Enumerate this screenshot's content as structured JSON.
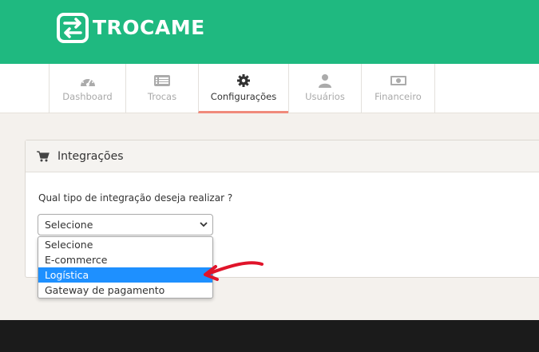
{
  "brand": {
    "name": "TROCAME",
    "color": "#1fb980"
  },
  "nav": {
    "tabs": [
      {
        "label": "Dashboard",
        "icon": "dashboard-gauge-icon",
        "active": false
      },
      {
        "label": "Trocas",
        "icon": "list-icon",
        "active": false
      },
      {
        "label": "Configurações",
        "icon": "gear-icon",
        "active": true
      },
      {
        "label": "Usuários",
        "icon": "user-icon",
        "active": false
      },
      {
        "label": "Financeiro",
        "icon": "money-icon",
        "active": false
      }
    ],
    "active_indicator_color": "#f08a7b"
  },
  "panel": {
    "icon": "cart-icon",
    "title": "Integrações",
    "question": "Qual tipo de integração deseja realizar ?",
    "select": {
      "value": "Selecione",
      "options": [
        "Selecione",
        "E-commerce",
        "Logística",
        "Gateway de pagamento"
      ],
      "highlighted": "Logística",
      "highlight_color": "#1e90ff"
    }
  },
  "annotation": {
    "color": "#e0142a"
  }
}
